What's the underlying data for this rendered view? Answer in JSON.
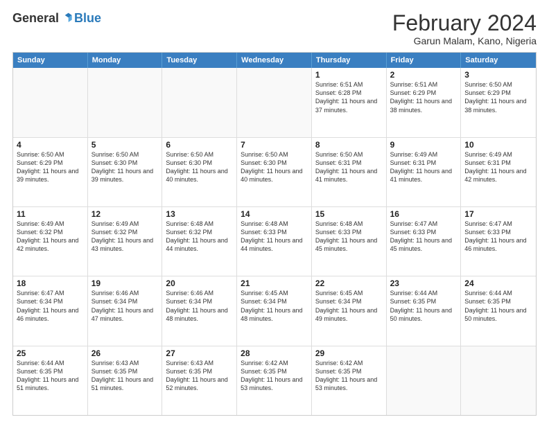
{
  "logo": {
    "general": "General",
    "blue": "Blue"
  },
  "header": {
    "month": "February 2024",
    "location": "Garun Malam, Kano, Nigeria"
  },
  "weekdays": [
    "Sunday",
    "Monday",
    "Tuesday",
    "Wednesday",
    "Thursday",
    "Friday",
    "Saturday"
  ],
  "rows": [
    [
      {
        "day": "",
        "info": ""
      },
      {
        "day": "",
        "info": ""
      },
      {
        "day": "",
        "info": ""
      },
      {
        "day": "",
        "info": ""
      },
      {
        "day": "1",
        "info": "Sunrise: 6:51 AM\nSunset: 6:28 PM\nDaylight: 11 hours and 37 minutes."
      },
      {
        "day": "2",
        "info": "Sunrise: 6:51 AM\nSunset: 6:29 PM\nDaylight: 11 hours and 38 minutes."
      },
      {
        "day": "3",
        "info": "Sunrise: 6:50 AM\nSunset: 6:29 PM\nDaylight: 11 hours and 38 minutes."
      }
    ],
    [
      {
        "day": "4",
        "info": "Sunrise: 6:50 AM\nSunset: 6:29 PM\nDaylight: 11 hours and 39 minutes."
      },
      {
        "day": "5",
        "info": "Sunrise: 6:50 AM\nSunset: 6:30 PM\nDaylight: 11 hours and 39 minutes."
      },
      {
        "day": "6",
        "info": "Sunrise: 6:50 AM\nSunset: 6:30 PM\nDaylight: 11 hours and 40 minutes."
      },
      {
        "day": "7",
        "info": "Sunrise: 6:50 AM\nSunset: 6:30 PM\nDaylight: 11 hours and 40 minutes."
      },
      {
        "day": "8",
        "info": "Sunrise: 6:50 AM\nSunset: 6:31 PM\nDaylight: 11 hours and 41 minutes."
      },
      {
        "day": "9",
        "info": "Sunrise: 6:49 AM\nSunset: 6:31 PM\nDaylight: 11 hours and 41 minutes."
      },
      {
        "day": "10",
        "info": "Sunrise: 6:49 AM\nSunset: 6:31 PM\nDaylight: 11 hours and 42 minutes."
      }
    ],
    [
      {
        "day": "11",
        "info": "Sunrise: 6:49 AM\nSunset: 6:32 PM\nDaylight: 11 hours and 42 minutes."
      },
      {
        "day": "12",
        "info": "Sunrise: 6:49 AM\nSunset: 6:32 PM\nDaylight: 11 hours and 43 minutes."
      },
      {
        "day": "13",
        "info": "Sunrise: 6:48 AM\nSunset: 6:32 PM\nDaylight: 11 hours and 44 minutes."
      },
      {
        "day": "14",
        "info": "Sunrise: 6:48 AM\nSunset: 6:33 PM\nDaylight: 11 hours and 44 minutes."
      },
      {
        "day": "15",
        "info": "Sunrise: 6:48 AM\nSunset: 6:33 PM\nDaylight: 11 hours and 45 minutes."
      },
      {
        "day": "16",
        "info": "Sunrise: 6:47 AM\nSunset: 6:33 PM\nDaylight: 11 hours and 45 minutes."
      },
      {
        "day": "17",
        "info": "Sunrise: 6:47 AM\nSunset: 6:33 PM\nDaylight: 11 hours and 46 minutes."
      }
    ],
    [
      {
        "day": "18",
        "info": "Sunrise: 6:47 AM\nSunset: 6:34 PM\nDaylight: 11 hours and 46 minutes."
      },
      {
        "day": "19",
        "info": "Sunrise: 6:46 AM\nSunset: 6:34 PM\nDaylight: 11 hours and 47 minutes."
      },
      {
        "day": "20",
        "info": "Sunrise: 6:46 AM\nSunset: 6:34 PM\nDaylight: 11 hours and 48 minutes."
      },
      {
        "day": "21",
        "info": "Sunrise: 6:45 AM\nSunset: 6:34 PM\nDaylight: 11 hours and 48 minutes."
      },
      {
        "day": "22",
        "info": "Sunrise: 6:45 AM\nSunset: 6:34 PM\nDaylight: 11 hours and 49 minutes."
      },
      {
        "day": "23",
        "info": "Sunrise: 6:44 AM\nSunset: 6:35 PM\nDaylight: 11 hours and 50 minutes."
      },
      {
        "day": "24",
        "info": "Sunrise: 6:44 AM\nSunset: 6:35 PM\nDaylight: 11 hours and 50 minutes."
      }
    ],
    [
      {
        "day": "25",
        "info": "Sunrise: 6:44 AM\nSunset: 6:35 PM\nDaylight: 11 hours and 51 minutes."
      },
      {
        "day": "26",
        "info": "Sunrise: 6:43 AM\nSunset: 6:35 PM\nDaylight: 11 hours and 51 minutes."
      },
      {
        "day": "27",
        "info": "Sunrise: 6:43 AM\nSunset: 6:35 PM\nDaylight: 11 hours and 52 minutes."
      },
      {
        "day": "28",
        "info": "Sunrise: 6:42 AM\nSunset: 6:35 PM\nDaylight: 11 hours and 53 minutes."
      },
      {
        "day": "29",
        "info": "Sunrise: 6:42 AM\nSunset: 6:35 PM\nDaylight: 11 hours and 53 minutes."
      },
      {
        "day": "",
        "info": ""
      },
      {
        "day": "",
        "info": ""
      }
    ]
  ]
}
